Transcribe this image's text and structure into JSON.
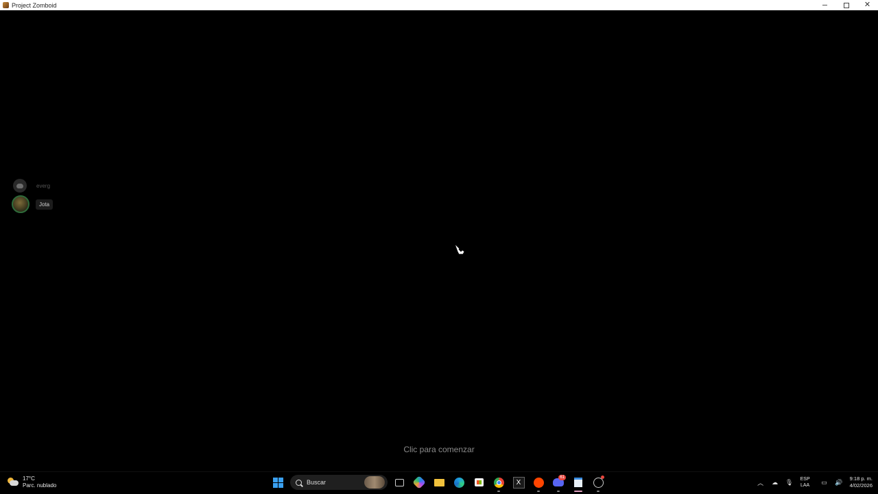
{
  "window": {
    "title": "Project Zomboid",
    "controls": {
      "minimize_icon": "minimize-icon",
      "maximize_icon": "restore-icon",
      "close_icon": "close-icon"
    }
  },
  "game": {
    "voice_users": [
      {
        "name": "everg",
        "avatar": "discord-icon",
        "state": "inactive"
      },
      {
        "name": "Jota",
        "avatar": "user-photo",
        "state": "speaking"
      }
    ],
    "click_to_start": "Clic para comenzar"
  },
  "taskbar": {
    "weather": {
      "temp": "17°C",
      "condition": "Parc. nublado"
    },
    "search_placeholder": "Buscar",
    "pinned": [
      "start-icon",
      "search",
      "task-view-icon",
      "copilot-icon",
      "file-explorer-icon",
      "edge-icon",
      "store-icon",
      "chrome-icon",
      "x-icon",
      "reddit-icon",
      "discord-icon",
      "notepad-icon",
      "steam-icon"
    ],
    "discord_badge": "61",
    "tray": {
      "language_line1": "ESP",
      "language_line2": "LAA",
      "time": "9:18 p. m.",
      "date": "4/02/2026"
    }
  },
  "colors": {
    "background": "#000000",
    "accent": "#3aa0f0",
    "speaking_ring": "#2e6b3a"
  }
}
